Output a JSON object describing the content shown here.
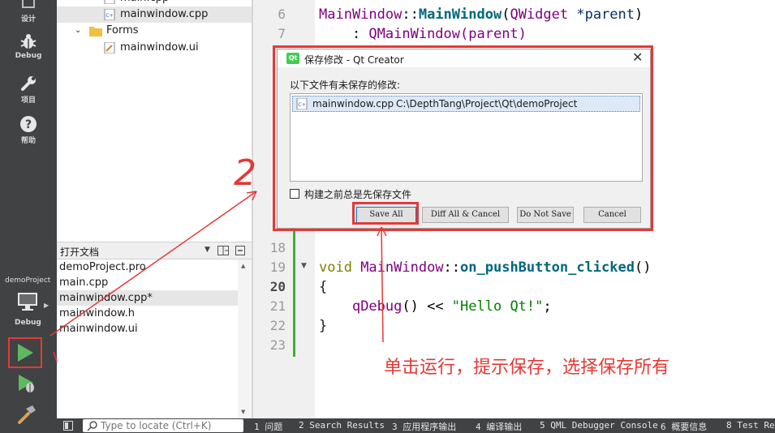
{
  "modes": {
    "design": "设计",
    "debug": "Debug",
    "project": "项目",
    "help": "帮助"
  },
  "kit": {
    "project": "demoProject",
    "build_config": "Debug"
  },
  "project_tree": {
    "items": [
      {
        "label": "main.cpp"
      },
      {
        "label": "mainwindow.cpp"
      },
      {
        "label": "Forms"
      },
      {
        "label": "mainwindow.ui"
      }
    ]
  },
  "open_docs": {
    "title": "打开文档",
    "items": [
      "demoProject.pro",
      "main.cpp",
      "mainwindow.cpp*",
      "mainwindow.h",
      "mainwindow.ui"
    ]
  },
  "editor": {
    "line_numbers": [
      "6",
      "7",
      "18",
      "19",
      "20",
      "21",
      "22",
      "23"
    ],
    "line6": {
      "cls": "MainWindow",
      "sep": "::",
      "fn": "MainWindow",
      "open": "(",
      "type": "QWidget",
      "arg": " *parent",
      "close": ")"
    },
    "line7": {
      "colon": "    : ",
      "base": "QMainWindow",
      "args": "(parent)"
    },
    "line19": {
      "kw": "void ",
      "cls": "MainWindow",
      "sep": "::",
      "fn": "on_pushButton_clicked",
      "parens": "()"
    },
    "line20": "{",
    "line21": {
      "indent": "    ",
      "fn": "qDebug",
      "rest": "() << ",
      "str": "\"Hello Qt!\"",
      "end": ";"
    },
    "line22": "}"
  },
  "dialog": {
    "logo": "Qt",
    "title": "保存修改 - Qt Creator",
    "close": "✕",
    "label": "以下文件有未保存的修改:",
    "file": {
      "name": "mainwindow.cpp",
      "path": "C:\\DepthTang\\Project\\Qt\\demoProject"
    },
    "checkbox_label": "构建之前总是先保存文件",
    "buttons": {
      "save_all": "Save All",
      "diff_all": "Diff All & Cancel",
      "do_not_save": "Do Not Save",
      "cancel": "Cancel"
    }
  },
  "statusbar": {
    "locator_placeholder": "Type to locate (Ctrl+K)",
    "tabs": [
      "1 问题",
      "2 Search Results",
      "3 应用程序输出",
      "4 编译输出",
      "5 QML Debugger Console",
      "6 概要信息",
      "8 Test Res"
    ]
  },
  "annotation": {
    "number": "2",
    "text": "单击运行，提示保存，选择保存所有",
    "color": "#e53935"
  }
}
